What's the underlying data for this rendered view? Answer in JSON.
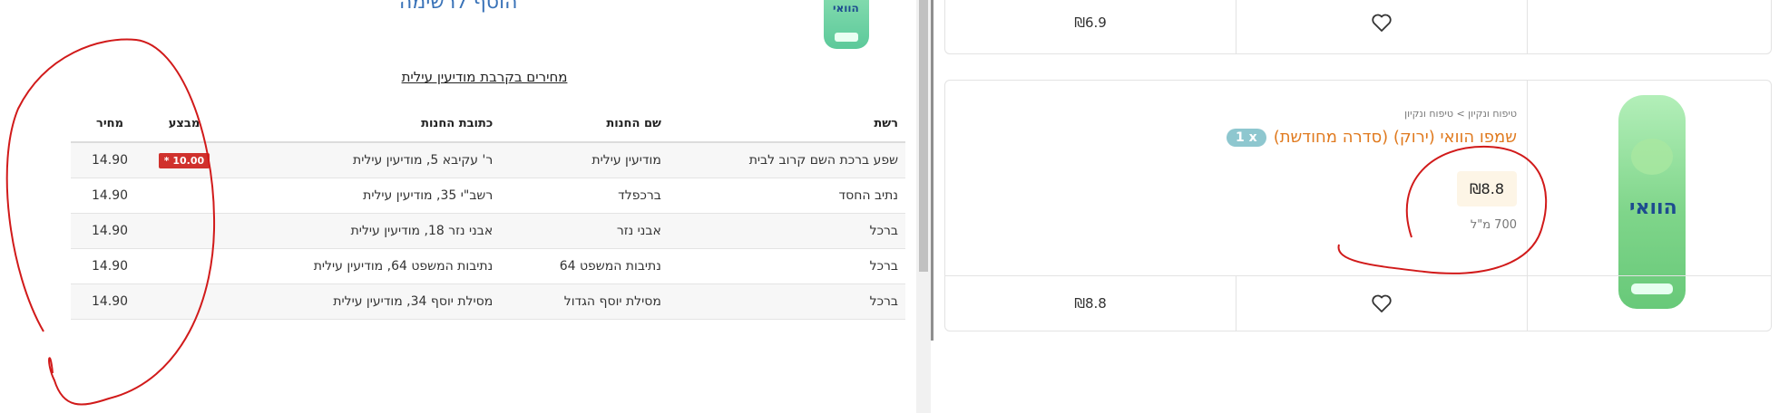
{
  "left": {
    "add_to_list": "הוסף לרשימה",
    "heading": "מחירים בקרבת מודיעין עילית",
    "table": {
      "headers": {
        "chain": "רשת",
        "store_name": "שם החנות",
        "store_address": "כתובת החנות",
        "promo": "מבצע",
        "price": "מחיר"
      },
      "rows": [
        {
          "chain": "שפע ברכת השם קרוב לבית",
          "store_name": "מודיעין עילית",
          "store_address": "ר' עקיבא 5, מודיעין עילית",
          "promo": "* 10.00",
          "price": "14.90"
        },
        {
          "chain": "נתיב החסד",
          "store_name": "ברכפלד",
          "store_address": "רשב\"י 35, מודיעין עילית",
          "promo": "",
          "price": "14.90"
        },
        {
          "chain": "ברכל",
          "store_name": "אבני נזר",
          "store_address": "אבני נזר 18, מודיעין עילית",
          "promo": "",
          "price": "14.90"
        },
        {
          "chain": "ברכל",
          "store_name": "נתיבות המשפט 64",
          "store_address": "נתיבות המשפט 64, מודיעין עילית",
          "promo": "",
          "price": "14.90"
        },
        {
          "chain": "ברכל",
          "store_name": "מסילת יוסף הגדול",
          "store_address": "מסילת יוסף 34, מודיעין עילית",
          "promo": "",
          "price": "14.90"
        }
      ]
    }
  },
  "right": {
    "top_card": {
      "price": "₪6.9"
    },
    "main_card": {
      "breadcrumb": "טיפוח ונקיון > טיפוח ונקיון",
      "title": "שמפו הוואי (ירוק) (סדרה מחודשת)",
      "qty": "1 x",
      "price": "₪8.8",
      "volume": "700 מ\"ל",
      "bottom_price": "₪8.8"
    }
  },
  "colors": {
    "title_orange": "#e07a1f",
    "link_blue": "#3a73b8",
    "promo_red": "#d0312d",
    "qty_teal": "#8ec7cf",
    "annotation_red": "#d11a1a"
  },
  "icons": [
    "heart-icon"
  ]
}
